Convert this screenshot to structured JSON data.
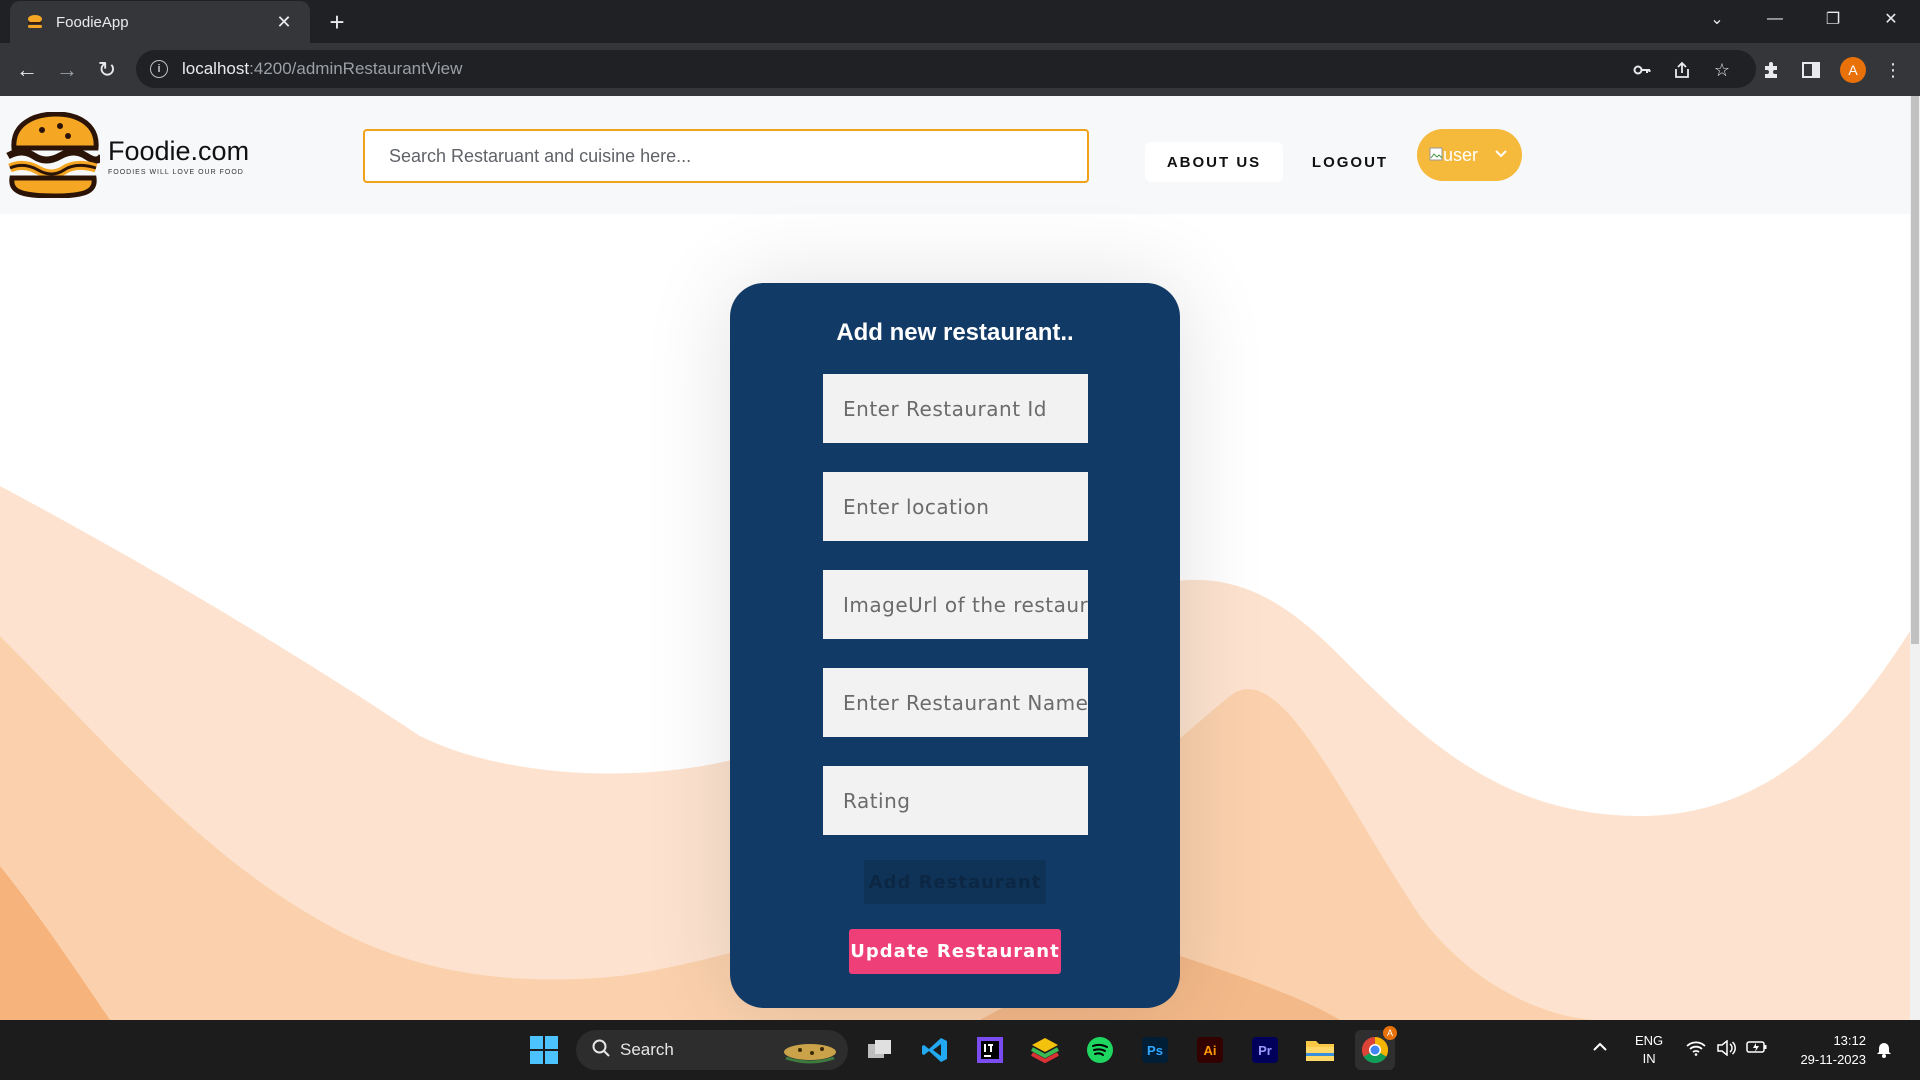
{
  "browser": {
    "tab_title": "FoodieApp",
    "tab_close": "✕",
    "new_tab": "+",
    "url_host": "localhost",
    "url_path": ":4200/adminRestaurantView"
  },
  "header": {
    "brand_name": "Foodie.com",
    "brand_tagline": "FOODIES WILL LOVE OUR FOOD",
    "search_placeholder": "Search Restaruant and cuisine here...",
    "about_label": "ABOUT US",
    "logout_label": "LOGOUT",
    "user_alt": "user"
  },
  "form": {
    "title": "Add new restaurant..",
    "fields": [
      {
        "placeholder": "Enter Restaurant Id"
      },
      {
        "placeholder": "Enter location"
      },
      {
        "placeholder": "ImageUrl of the restaurant"
      },
      {
        "placeholder": "Enter Restaurant Name"
      },
      {
        "placeholder": "Rating"
      }
    ],
    "add_label": "Add Restaurant",
    "update_label": "Update Restaurant"
  },
  "taskbar": {
    "search_label": "Search",
    "lang_top": "ENG",
    "lang_bottom": "IN",
    "time": "13:12",
    "date": "29-11-2023"
  },
  "colors": {
    "card": "#123a66",
    "accent_orange": "#f5b93b",
    "update_pink": "#ef3f78"
  }
}
